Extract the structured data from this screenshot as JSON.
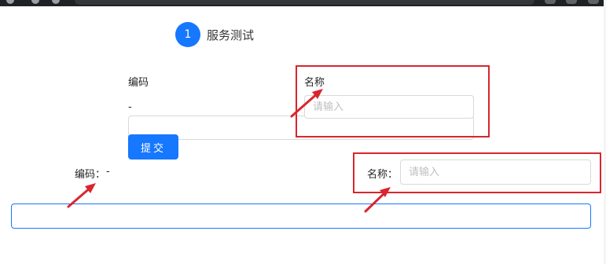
{
  "step": {
    "number": "1",
    "title": "服务测试"
  },
  "form_top": {
    "code_label": "编码",
    "code_value": "-",
    "name_label": "名称",
    "name_placeholder": "请输入",
    "submit_label": "提交"
  },
  "form_bottom": {
    "code_label": "编码：",
    "code_value": "-",
    "name_label": "名称：",
    "name_placeholder": "请输入"
  },
  "colors": {
    "primary": "#1677ff",
    "annotation_red": "#d9262e",
    "input_border": "#d9d9d9"
  }
}
